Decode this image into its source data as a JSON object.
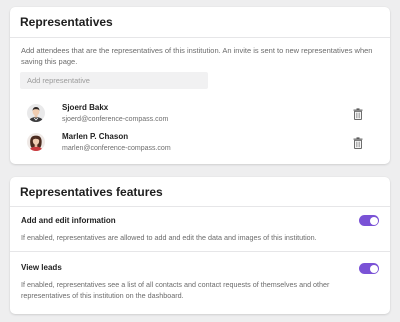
{
  "representatives": {
    "title": "Representatives",
    "description": "Add attendees that are the representatives of this institution. An invite is sent to new representatives when saving this page.",
    "add_placeholder": "Add representative",
    "items": [
      {
        "name": "Sjoerd Bakx",
        "email": "sjoerd@conference-compass.com",
        "avatar_icon": "male-person-avatar"
      },
      {
        "name": "Marlen P. Chason",
        "email": "marlen@conference-compass.com",
        "avatar_icon": "female-person-avatar"
      }
    ]
  },
  "features": {
    "title": "Representatives features",
    "items": [
      {
        "title": "Add and edit information",
        "description": "If enabled, representatives are allowed to add and edit the data and images of this institution.",
        "enabled": true
      },
      {
        "title": "View leads",
        "description": "If enabled, representatives see a list of all contacts and contact requests of themselves and other representatives of this institution on the dashboard.",
        "enabled": true
      }
    ]
  },
  "colors": {
    "toggle_on": "#7a52d6",
    "background": "#eeeeef"
  }
}
